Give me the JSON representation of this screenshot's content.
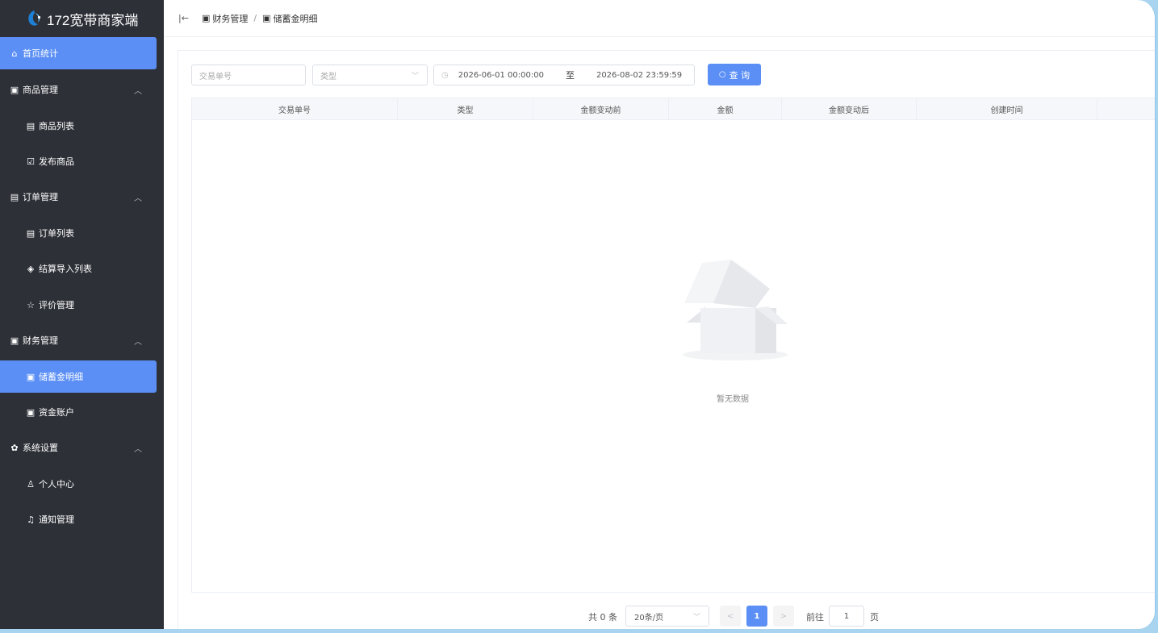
{
  "app": {
    "title": "172宽带商家端"
  },
  "sidebar": {
    "items": [
      {
        "label": "首页统计",
        "icon": "home-icon",
        "glyph": "⌂"
      },
      {
        "label": "商品管理",
        "icon": "product-icon",
        "glyph": "▣"
      },
      {
        "label": "商品列表",
        "icon": "list-icon",
        "glyph": "▤"
      },
      {
        "label": "发布商品",
        "icon": "edit-icon",
        "glyph": "☑"
      },
      {
        "label": "订单管理",
        "icon": "order-icon",
        "glyph": "▤"
      },
      {
        "label": "订单列表",
        "icon": "list-icon",
        "glyph": "▤"
      },
      {
        "label": "结算导入列表",
        "icon": "tag-icon",
        "glyph": "◈"
      },
      {
        "label": "评价管理",
        "icon": "star-icon",
        "glyph": "☆"
      },
      {
        "label": "财务管理",
        "icon": "wallet-icon",
        "glyph": "▣"
      },
      {
        "label": "储蓄金明细",
        "icon": "detail-icon",
        "glyph": "▣"
      },
      {
        "label": "资金账户",
        "icon": "account-icon",
        "glyph": "▣"
      },
      {
        "label": "系统设置",
        "icon": "gear-icon",
        "glyph": "✿"
      },
      {
        "label": "个人中心",
        "icon": "user-icon",
        "glyph": "♙"
      },
      {
        "label": "通知管理",
        "icon": "bell-icon",
        "glyph": "♫"
      }
    ]
  },
  "breadcrumb": {
    "parent": "财务管理",
    "separator": "/",
    "current": "储蓄金明细"
  },
  "filters": {
    "order_placeholder": "交易单号",
    "type_placeholder": "类型",
    "date_start": "2026-06-01 00:00:00",
    "date_to": "至",
    "date_end": "2026-08-02 23:59:59",
    "search_label": "查 询"
  },
  "table": {
    "columns": [
      "交易单号",
      "类型",
      "金额变动前",
      "金额",
      "金额变动后",
      "创建时间"
    ],
    "empty_text": "暂无数据"
  },
  "pagination": {
    "total": "共 0 条",
    "page_size": "20条/页",
    "current_page": "1",
    "goto_label": "前往",
    "goto_value": "1",
    "page_word": "页"
  },
  "colors": {
    "accent": "#5b8ff5",
    "sidebar": "#2d3037",
    "background": "#a9d4f0"
  }
}
